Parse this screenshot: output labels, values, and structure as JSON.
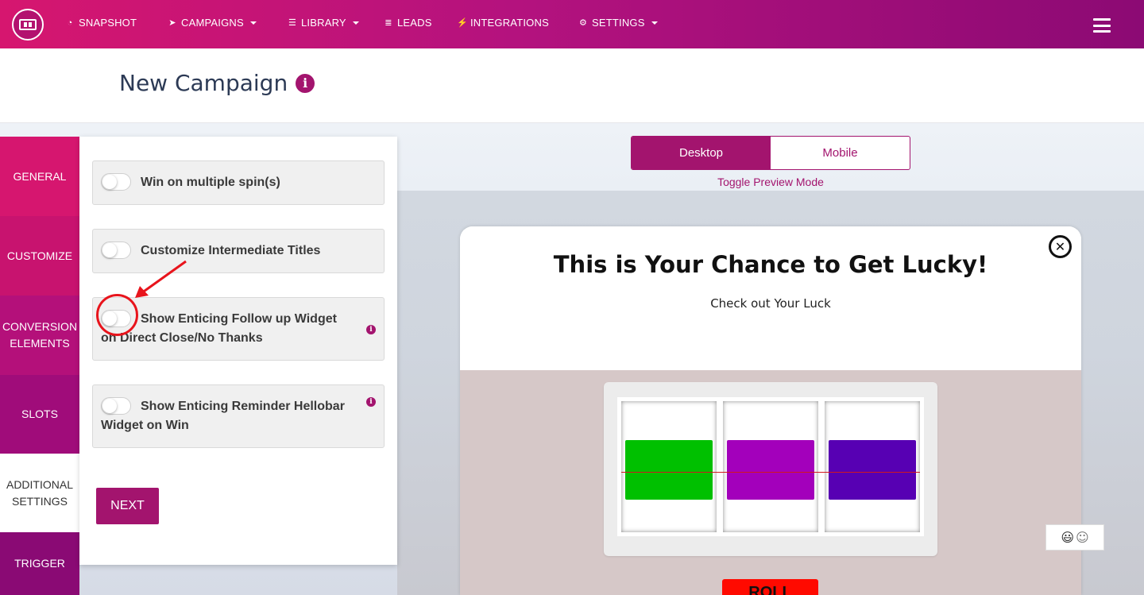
{
  "topnav": {
    "items": [
      {
        "label": "SNAPSHOT",
        "icon": "dashboard-icon"
      },
      {
        "label": "CAMPAIGNS",
        "icon": "paper-plane-icon"
      },
      {
        "label": "LIBRARY",
        "icon": "library-icon"
      },
      {
        "label": "LEADS",
        "icon": "list-icon"
      },
      {
        "label": "INTEGRATIONS",
        "icon": "plug-icon"
      },
      {
        "label": "SETTINGS",
        "icon": "gears-icon"
      }
    ],
    "colors": {
      "start": "#d6166f",
      "end": "#8c0a74"
    }
  },
  "page": {
    "title": "New Campaign"
  },
  "sidebar": {
    "items": [
      {
        "label": "GENERAL"
      },
      {
        "label": "CUSTOMIZE"
      },
      {
        "label": "CONVERSION ELEMENTS"
      },
      {
        "label": "SLOTS"
      },
      {
        "label": "ADDITIONAL SETTINGS",
        "active": true
      },
      {
        "label": "TRIGGER"
      }
    ]
  },
  "settings": {
    "options": [
      {
        "label": "Win on multiple spin(s)",
        "enabled": false
      },
      {
        "label": "Customize Intermediate Titles",
        "enabled": false
      },
      {
        "label": "Show Enticing Follow up Widget on Direct Close/No Thanks",
        "enabled": false
      },
      {
        "label": "Show Enticing Reminder Hellobar Widget on Win",
        "enabled": false
      }
    ],
    "next_label": "NEXT"
  },
  "preview": {
    "modes": [
      "Desktop",
      "Mobile"
    ],
    "selected_mode": "Desktop",
    "caption": "Toggle Preview Mode",
    "popup": {
      "title": "This is Your Chance to Get Lucky!",
      "subtitle": "Check out Your Luck",
      "reel_colors": [
        "#00c000",
        "#a300bb",
        "#5700b3"
      ],
      "button_label": "ROLL"
    }
  },
  "accent_color": "#a3146e"
}
